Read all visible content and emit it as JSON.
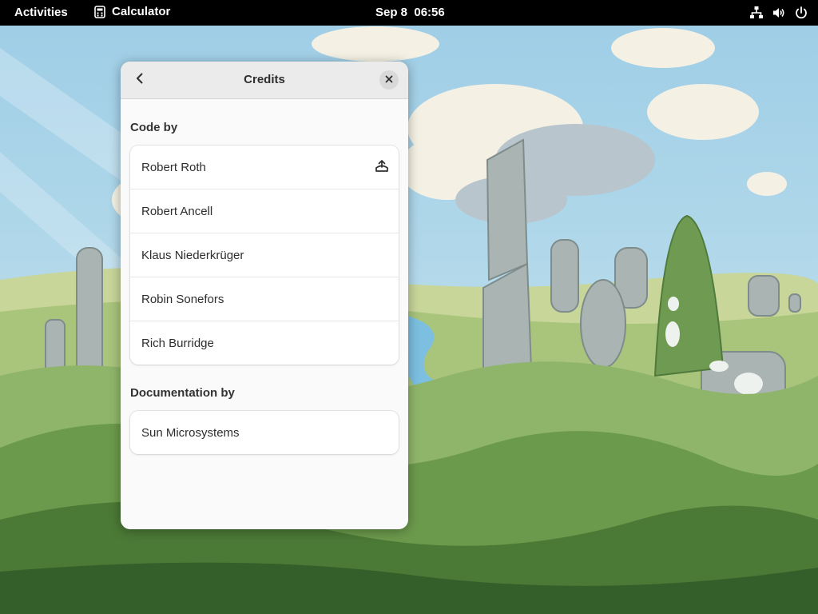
{
  "topbar": {
    "activities_label": "Activities",
    "app_name": "Calculator",
    "clock": "Sep 8  06:56",
    "icons": [
      "calculator-icon",
      "network-icon",
      "volume-icon",
      "power-icon"
    ]
  },
  "dialog": {
    "title": "Credits",
    "back_icon": "chevron-left-icon",
    "close_icon": "close-icon",
    "sections": [
      {
        "heading": "Code by",
        "people": [
          "Robert Roth",
          "Robert Ancell",
          "Klaus Niederkrüger",
          "Robin Sonefors",
          "Rich Burridge"
        ],
        "first_row_icon": "send-to-icon"
      },
      {
        "heading": "Documentation by",
        "people": [
          "Sun Microsystems"
        ]
      }
    ]
  },
  "colors": {
    "topbar_bg": "#000000",
    "dialog_bg": "#fafafa",
    "header_bg": "#ebebeb",
    "sky": "#a9d4e8",
    "grass": "#8fb56a"
  }
}
